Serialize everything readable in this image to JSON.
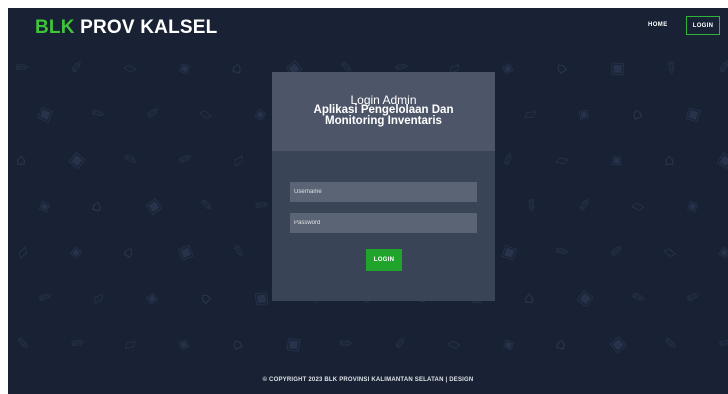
{
  "brand": {
    "accent": "BLK",
    "rest": " PROV KALSEL"
  },
  "nav": {
    "home_label": "HOME",
    "login_label": "LOGIN"
  },
  "login_card": {
    "title": "Login Admin",
    "subtitle_line1": "Aplikasi Pengelolaan Dan",
    "subtitle_line2": "Monitoring Inventaris",
    "username_placeholder": "Username",
    "password_placeholder": "Password",
    "submit_label": "LOGIN"
  },
  "footer": {
    "text": "© COPYRIGHT 2023 BLK PROVINSI KALIMANTAN SELATAN | DESIGN"
  },
  "colors": {
    "background": "#182234",
    "brand_accent": "#3ec53a",
    "button": "#21a42c",
    "card": "#3a4457",
    "card_header": "#4d5668",
    "pattern": "#28324a"
  },
  "pattern_icons": [
    "pencil",
    "paint-roller",
    "brush",
    "ruler",
    "trash",
    "shoe"
  ]
}
